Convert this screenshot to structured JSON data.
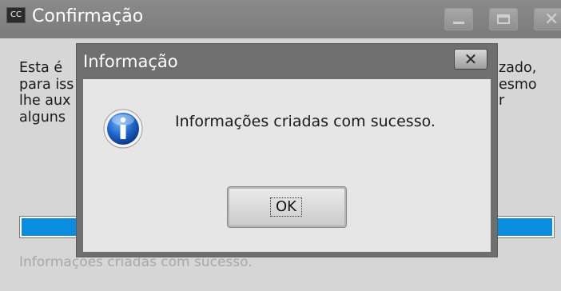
{
  "window": {
    "app_icon": "CC",
    "title": "Confirmação",
    "body_lines": [
      "Esta é",
      "para iss",
      "lhe aux",
      "alguns"
    ],
    "body_right_fragments": [
      "zado,",
      "esmo",
      "r"
    ],
    "progress": 1.0,
    "status_text": "Informações criadas com sucesso."
  },
  "dialog": {
    "title": "Informação",
    "message": "Informações criadas com sucesso.",
    "ok_label": "OK",
    "icon": "info-icon"
  },
  "colors": {
    "progress_fill": "#0a8de0",
    "titlebar": "#7b7b7b",
    "dialog_frame": "#6f6f6f"
  }
}
